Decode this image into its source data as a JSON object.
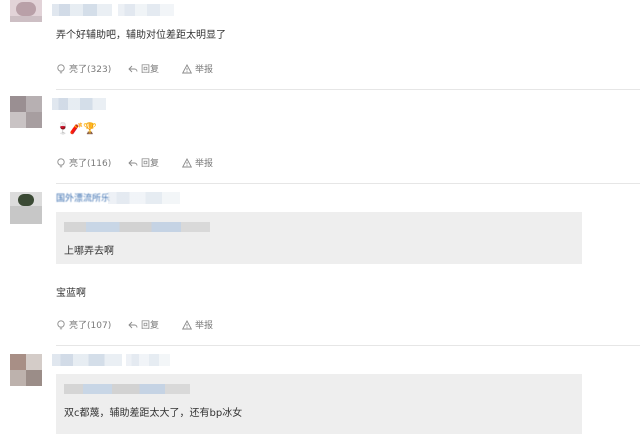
{
  "comments": [
    {
      "text": "弄个好辅助吧，辅助对位差距太明显了",
      "actions": {
        "like": "亮了(323)",
        "reply": "回复",
        "report": "举报"
      }
    },
    {
      "text": "🍷🧨🏆",
      "actions": {
        "like": "亮了(116)",
        "reply": "回复",
        "report": "举报"
      }
    },
    {
      "username": "国外漂流所乐",
      "quote": "上哪弄去啊",
      "text": "宝蓝啊",
      "actions": {
        "like": "亮了(107)",
        "reply": "回复",
        "report": "举报"
      }
    },
    {
      "quote": "双c都蔑，辅助差距太大了，还有bp冰女"
    }
  ],
  "icons": {
    "like": "lightbulb-icon",
    "reply": "reply-arrow-icon",
    "report": "warning-triangle-icon"
  }
}
